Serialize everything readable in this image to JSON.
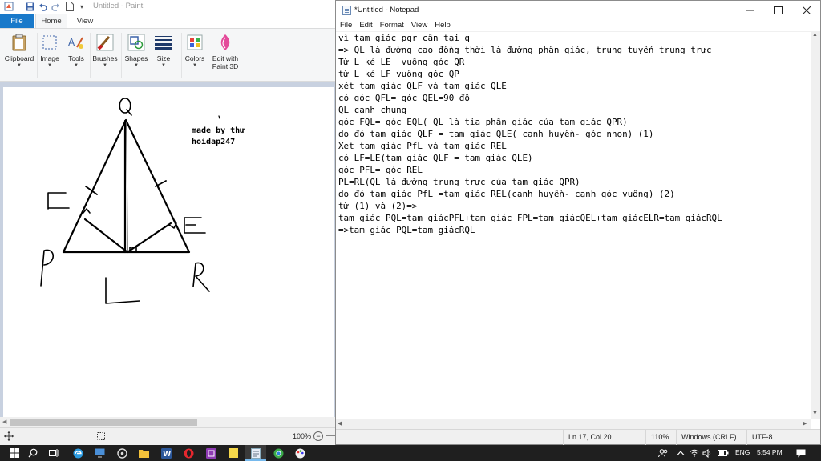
{
  "paint": {
    "title": "Untitled - Paint",
    "tabs": {
      "file": "File",
      "home": "Home",
      "view": "View"
    },
    "ribbon": {
      "clipboard": "Clipboard",
      "image": "Image",
      "tools": "Tools",
      "brushes": "Brushes",
      "shapes": "Shapes",
      "size": "Size",
      "colors": "Colors",
      "edit_line1": "Edit with",
      "edit_line2": "Paint 3D"
    },
    "canvas_text": {
      "line1": "made by thư",
      "line2": "hoidap247"
    },
    "status": {
      "zoom": "100%"
    }
  },
  "notepad": {
    "title": "*Untitled - Notepad",
    "menu": [
      "File",
      "Edit",
      "Format",
      "View",
      "Help"
    ],
    "lines": [
      "vì tam giác pqr cân tại q",
      "=> QL là đường cao đồng thời là đường phân giác, trung tuyến trung trực",
      "Từ L kẻ LE  vuông góc QR",
      "từ L kẻ LF vuông góc QP",
      "xét tam giác QLF và tam giác QLE",
      "có góc QFL= góc QEL=90 độ",
      "QL cạnh chung",
      "góc FQL= góc EQL( QL là tia phân giác của tam giác QPR)",
      "do đó tam giác QLF = tam giác QLE( cạnh huyền- góc nhọn) (1)",
      "Xet tam giác PfL và tam giác REL",
      "có LF=LE(tam giác QLF = tam giác QLE)",
      "góc PFL= góc REL",
      "PL=RL(QL là đường trung trực của tam giác QPR)",
      "do đó tam giác PfL =tam giác REL(cạnh huyền- cạnh góc vuông) (2)",
      "từ (1) và (2)=>",
      "tam giác PQL=tam giácPFL+tam giác FPL=tam giácQEL+tam giácELR=tam giácRQL",
      "=>tam giác PQL=tam giácRQL"
    ],
    "status": {
      "position": "Ln 17, Col 20",
      "zoom": "110%",
      "line_ending": "Windows (CRLF)",
      "encoding": "UTF-8"
    }
  },
  "taskbar": {
    "language": "ENG",
    "time": "5:54 PM"
  },
  "colors": {
    "file_tab": "#1979ca",
    "canvas_bg": "#c8d1e0",
    "taskbar_bg": "#1f1f1f"
  }
}
